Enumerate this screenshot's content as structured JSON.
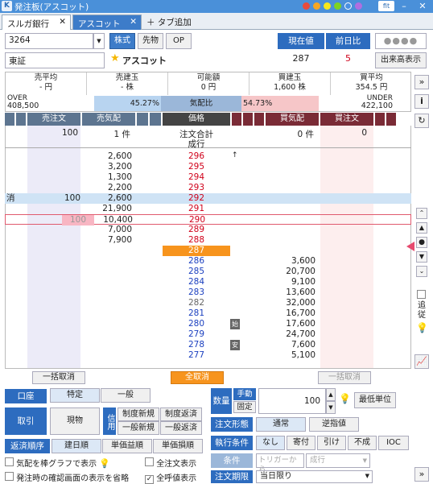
{
  "window": {
    "title": "発注板(アスコット)",
    "fit_label": "fit"
  },
  "tabs": [
    {
      "label": "スルガ銀行"
    },
    {
      "label": "アスコット"
    },
    {
      "label": "＋ タブ追加"
    }
  ],
  "symbol": {
    "code": "3264",
    "exchange": "東証",
    "name": "アスコット",
    "type_buttons": [
      "株式",
      "先物",
      "OP"
    ]
  },
  "quote": {
    "current_label": "現在値",
    "prev_label": "前日比",
    "current": "287",
    "change": "5",
    "volume_button": "出来高表示",
    "dots": "●●●●"
  },
  "summary": {
    "headers": [
      "売平均",
      "売建玉",
      "可能額",
      "買建玉",
      "買平均"
    ],
    "values": [
      "- 円",
      "- 株",
      "0 円",
      "1,600 株",
      "354.5 円"
    ],
    "over_label": "OVER",
    "over_value": "408,500",
    "under_label": "UNDER",
    "under_value": "422,100",
    "sell_pct": "45.27%",
    "ratio_label": "気配比",
    "buy_pct": "54.73%",
    "sell_ratio": 0.4527,
    "buy_ratio": 0.5473
  },
  "columns": {
    "sell_order": "売注文",
    "sell_quote": "売気配",
    "price": "価格",
    "buy_quote": "買気配",
    "buy_order": "買注文"
  },
  "top_row": {
    "sell_order": "100",
    "sell_count": "1 件",
    "order_total": "注文合計",
    "buy_count": "0 件",
    "buy_order": "0"
  },
  "market_label": "成行",
  "rows": [
    {
      "side": "",
      "sorder": "",
      "sell": "2,600",
      "price": "296",
      "tag": "",
      "buy": ""
    },
    {
      "side": "",
      "sorder": "",
      "sell": "3,200",
      "price": "295",
      "tag": "",
      "buy": ""
    },
    {
      "side": "",
      "sorder": "",
      "sell": "1,300",
      "price": "294",
      "tag": "",
      "buy": ""
    },
    {
      "side": "",
      "sorder": "",
      "sell": "2,200",
      "price": "293",
      "tag": "",
      "buy": ""
    },
    {
      "side": "消",
      "sorder": "100",
      "sell": "2,600",
      "price": "292",
      "tag": "",
      "buy": ""
    },
    {
      "side": "",
      "sorder": "",
      "sell": "21,900",
      "price": "291",
      "tag": "",
      "buy": ""
    },
    {
      "side": "",
      "sorder": "100",
      "sell": "10,400",
      "price": "290",
      "tag": "",
      "buy": ""
    },
    {
      "side": "",
      "sorder": "",
      "sell": "7,000",
      "price": "289",
      "tag": "",
      "buy": ""
    },
    {
      "side": "",
      "sorder": "",
      "sell": "7,900",
      "price": "288",
      "tag": "",
      "buy": ""
    },
    {
      "side": "",
      "sorder": "",
      "sell": "",
      "price": "287",
      "tag": "",
      "buy": ""
    },
    {
      "side": "",
      "sorder": "",
      "sell": "",
      "price": "286",
      "tag": "",
      "buy": "3,600"
    },
    {
      "side": "",
      "sorder": "",
      "sell": "",
      "price": "285",
      "tag": "",
      "buy": "20,700"
    },
    {
      "side": "",
      "sorder": "",
      "sell": "",
      "price": "284",
      "tag": "",
      "buy": "9,100"
    },
    {
      "side": "",
      "sorder": "",
      "sell": "",
      "price": "283",
      "tag": "",
      "buy": "13,600"
    },
    {
      "side": "",
      "sorder": "",
      "sell": "",
      "price": "282",
      "tag": "",
      "buy": "32,000"
    },
    {
      "side": "",
      "sorder": "",
      "sell": "",
      "price": "281",
      "tag": "",
      "buy": "16,700"
    },
    {
      "side": "",
      "sorder": "",
      "sell": "",
      "price": "280",
      "tag": "始",
      "buy": "17,600"
    },
    {
      "side": "",
      "sorder": "",
      "sell": "",
      "price": "279",
      "tag": "",
      "buy": "24,700"
    },
    {
      "side": "",
      "sorder": "",
      "sell": "",
      "price": "278",
      "tag": "安",
      "buy": "7,600"
    },
    {
      "side": "",
      "sorder": "",
      "sell": "",
      "price": "277",
      "tag": "",
      "buy": "5,100"
    }
  ],
  "cancel": {
    "left": "一括取消",
    "all": "全取消",
    "right": "一括取消"
  },
  "form": {
    "account_label": "口座",
    "account_opts": [
      "特定",
      "一般"
    ],
    "trade_label": "取引",
    "spot": "現物",
    "credit": "信用",
    "credit_opts": [
      "制度新規",
      "制度返済",
      "一般新規",
      "一般返済"
    ],
    "sort_label": "返済順序",
    "sort_opts": [
      "建日順",
      "単価益順",
      "単価損順"
    ],
    "qty_label": "数量",
    "qty_manual": "手動",
    "qty_fixed": "固定",
    "qty_value": "100",
    "min_unit": "最低単位",
    "form_label": "注文形態",
    "form_opts": [
      "通常",
      "逆指値"
    ],
    "cond_label": "執行条件",
    "cond_opts": [
      "なし",
      "寄付",
      "引け",
      "不成",
      "IOC"
    ],
    "cond2_label": "条件",
    "trigger_placeholder": "トリガーから",
    "trigger_select": "成行",
    "period_label": "注文期限",
    "period_value": "当日限り"
  },
  "checks": [
    {
      "label": "気配を棒グラフで表示",
      "checked": false
    },
    {
      "label": "全注文表示",
      "checked": false
    },
    {
      "label": "発注時の確認画面の表示を省略",
      "checked": false
    },
    {
      "label": "全呼値表示",
      "checked": true
    }
  ],
  "side_panel": {
    "follow_label": "追従"
  },
  "colors": {
    "accent": "#2d6cbf",
    "sell": "#6b7fa0",
    "buy": "#8a2c3c",
    "current": "#f7941d",
    "price_up": "#d0021b",
    "price_down": "#1a3fbf"
  }
}
